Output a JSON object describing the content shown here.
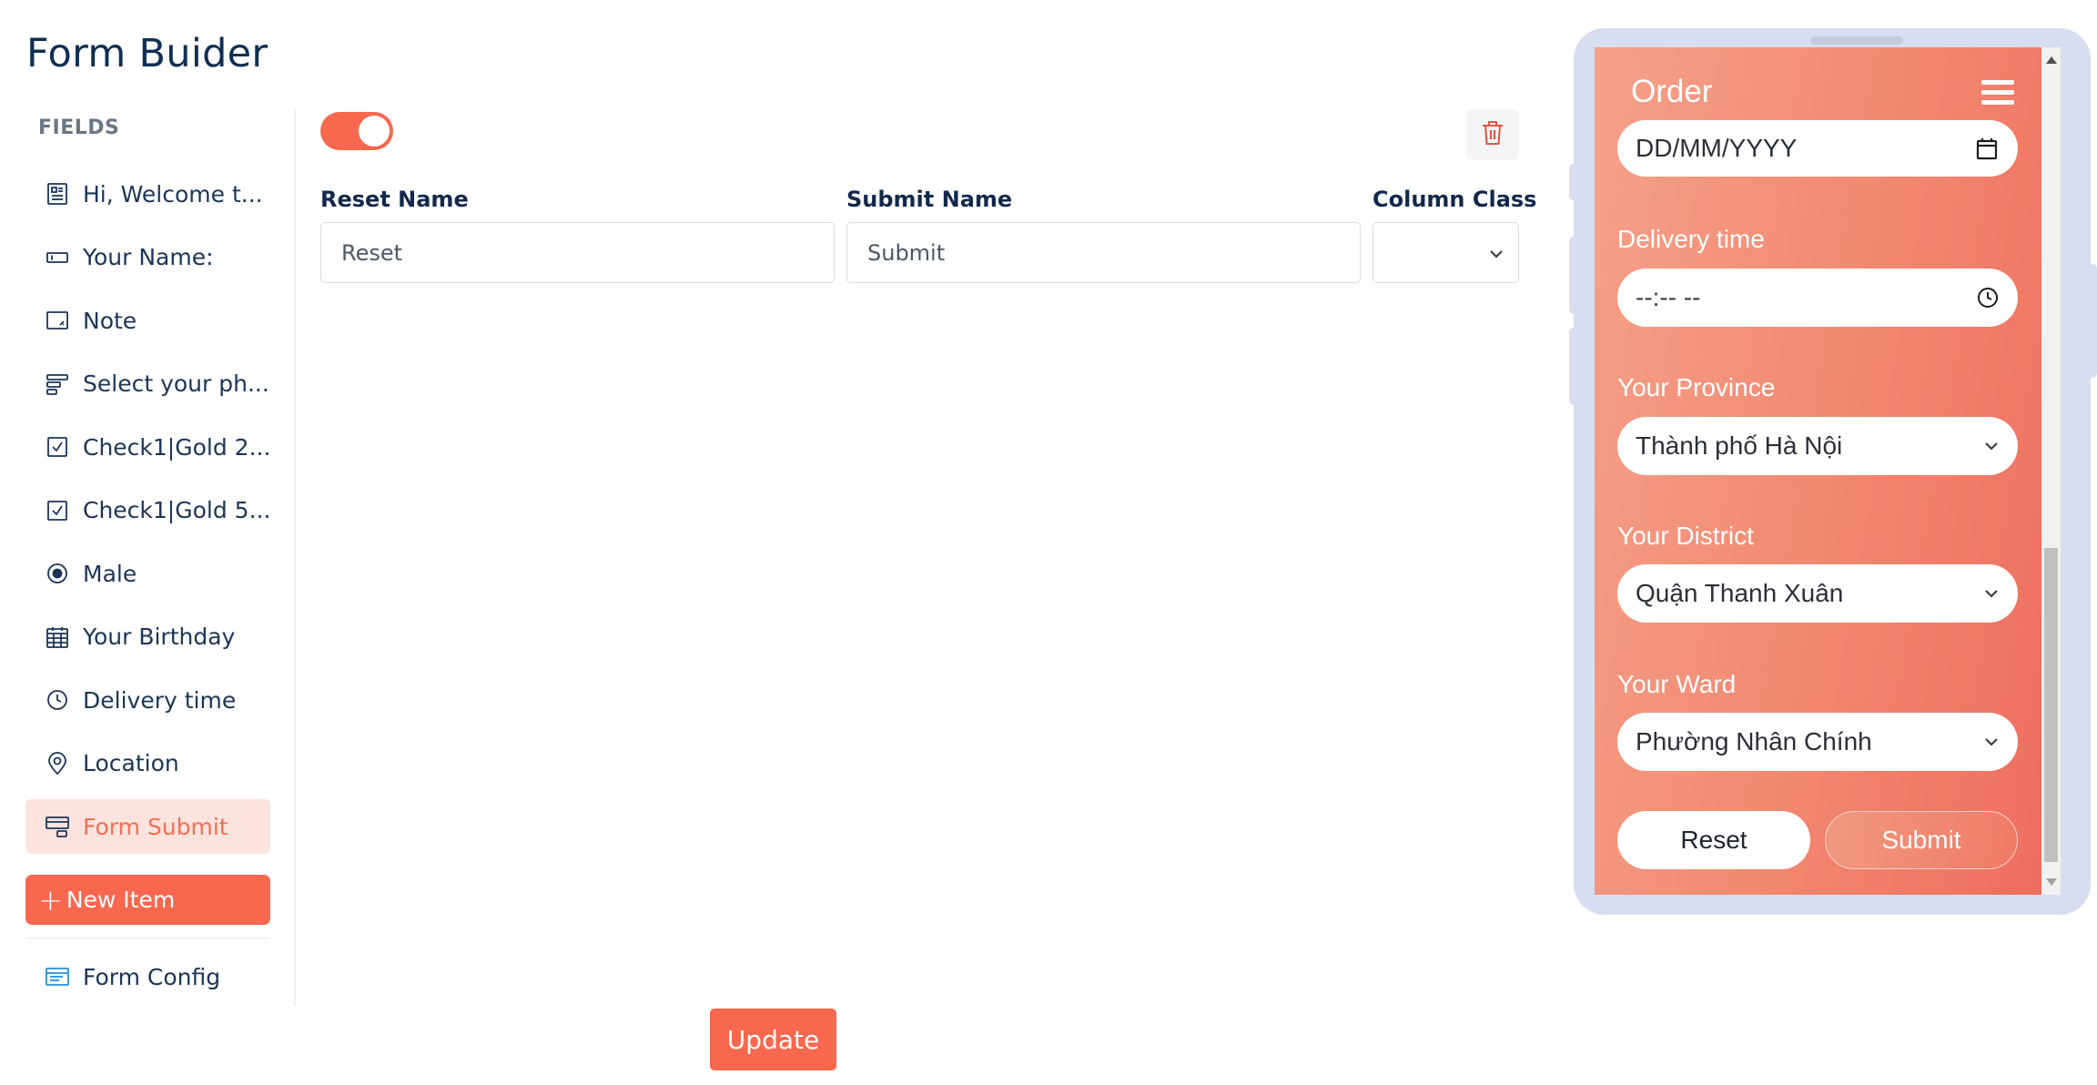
{
  "app": {
    "title": "Form Buider"
  },
  "sidebar": {
    "section_label": "FIELDS",
    "items": [
      {
        "label": "Hi, Welcome t...",
        "icon": "text-block-icon",
        "active": false
      },
      {
        "label": "Your Name:",
        "icon": "text-input-icon",
        "active": false
      },
      {
        "label": "Note",
        "icon": "textarea-icon",
        "active": false
      },
      {
        "label": "Select your ph...",
        "icon": "select-list-icon",
        "active": false
      },
      {
        "label": "Check1|Gold 2...",
        "icon": "checkbox-icon",
        "active": false
      },
      {
        "label": "Check1|Gold 5...",
        "icon": "checkbox-icon",
        "active": false
      },
      {
        "label": "Male",
        "icon": "radio-icon",
        "active": false
      },
      {
        "label": "Your Birthday",
        "icon": "calendar-icon",
        "active": false
      },
      {
        "label": "Delivery time",
        "icon": "clock-icon",
        "active": false
      },
      {
        "label": "Location",
        "icon": "location-pin-icon",
        "active": false
      },
      {
        "label": "Form Submit",
        "icon": "form-submit-icon",
        "active": true
      }
    ],
    "new_item_label": "New Item",
    "form_config_label": "Form Config"
  },
  "editor": {
    "toggle_on": true,
    "reset_name_label": "Reset Name",
    "reset_name_value": "Reset",
    "submit_name_label": "Submit Name",
    "submit_name_value": "Submit",
    "column_class_label": "Column Class",
    "column_class_value": "",
    "update_label": "Update"
  },
  "preview": {
    "title": "Order",
    "date_value": "DD/MM/YYYY",
    "delivery_label": "Delivery time",
    "delivery_value": "--:-- --",
    "province_label": "Your Province",
    "province_value": "Thành phố Hà Nội",
    "district_label": "Your District",
    "district_value": "Quận Thanh Xuân",
    "ward_label": "Your Ward",
    "ward_value": "Phường Nhân Chính",
    "reset_label": "Reset",
    "submit_label": "Submit"
  },
  "colors": {
    "accent": "#f7684e",
    "active_bg": "#fde3dd",
    "navy": "#13294b",
    "phone_frame": "#d7def0"
  }
}
